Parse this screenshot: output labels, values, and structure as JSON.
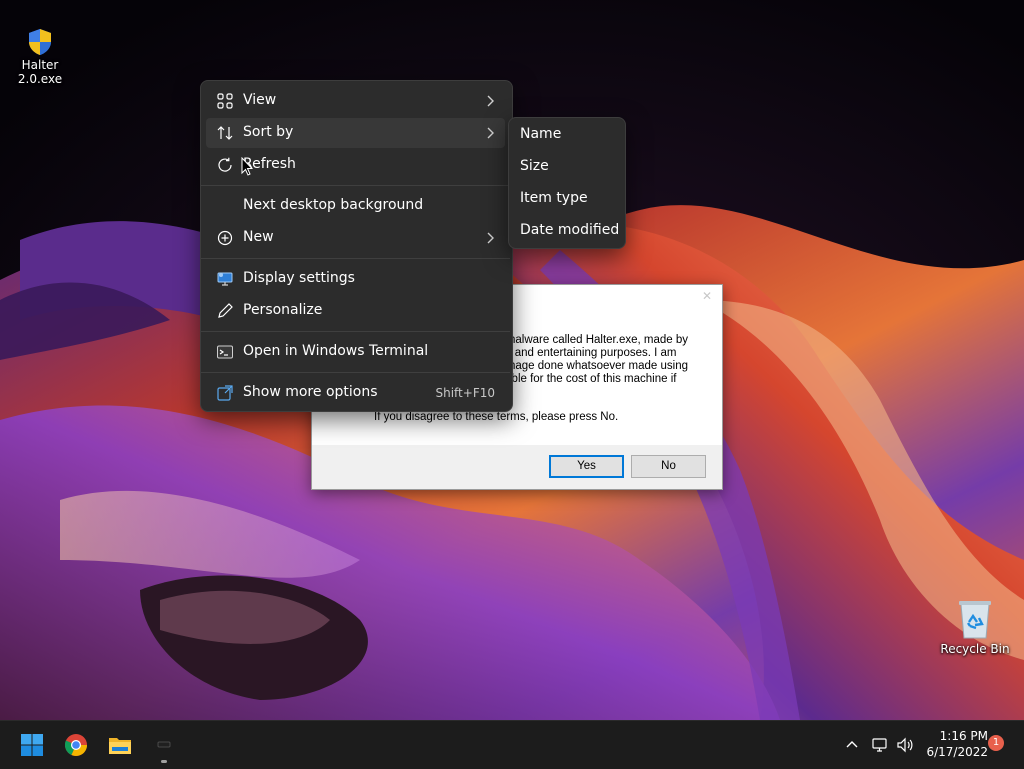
{
  "desktop": {
    "icons": [
      {
        "name": "Halter 2.0.exe",
        "icon": "shield-icon"
      },
      {
        "name": "Recycle Bin",
        "icon": "recycle-bin-icon"
      }
    ]
  },
  "dialog": {
    "lines": [
      "nalware called Halter.exe, made by",
      "l and entertaining purposes. I am",
      "nage done whatsoever made using",
      "ible for the cost of this machine if"
    ],
    "disagree_text": "If you disagree to these terms, please press No.",
    "yes_label": "Yes",
    "no_label": "No"
  },
  "context_menu": {
    "items": [
      {
        "label": "View",
        "icon": "grid-icon",
        "has_submenu": true
      },
      {
        "label": "Sort by",
        "icon": "sort-arrows-icon",
        "has_submenu": true
      },
      {
        "label": "Refresh",
        "icon": "refresh-icon"
      },
      {
        "label": "Next desktop background"
      },
      {
        "label": "New",
        "icon": "plus-circle-icon",
        "has_submenu": true
      },
      {
        "label": "Display settings",
        "icon": "display-icon"
      },
      {
        "label": "Personalize",
        "icon": "pen-icon"
      },
      {
        "label": "Open in Windows Terminal",
        "icon": "terminal-icon"
      },
      {
        "label": "Show more options",
        "icon": "expand-icon",
        "accelerator": "Shift+F10"
      }
    ]
  },
  "sort_submenu": {
    "items": [
      "Name",
      "Size",
      "Item type",
      "Date modified"
    ]
  },
  "taskbar": {
    "apps": [
      "Start",
      "Google Chrome",
      "File Explorer",
      "Halter 2.0"
    ],
    "clock": {
      "time": "1:16 PM",
      "date": "6/17/2022"
    },
    "notification_count": "1"
  },
  "colors": {
    "menu_bg": "#2c2c2c",
    "taskbar_bg": "#1c1c1c",
    "windows_blue": "#0078d4",
    "badge": "#e8604c"
  }
}
